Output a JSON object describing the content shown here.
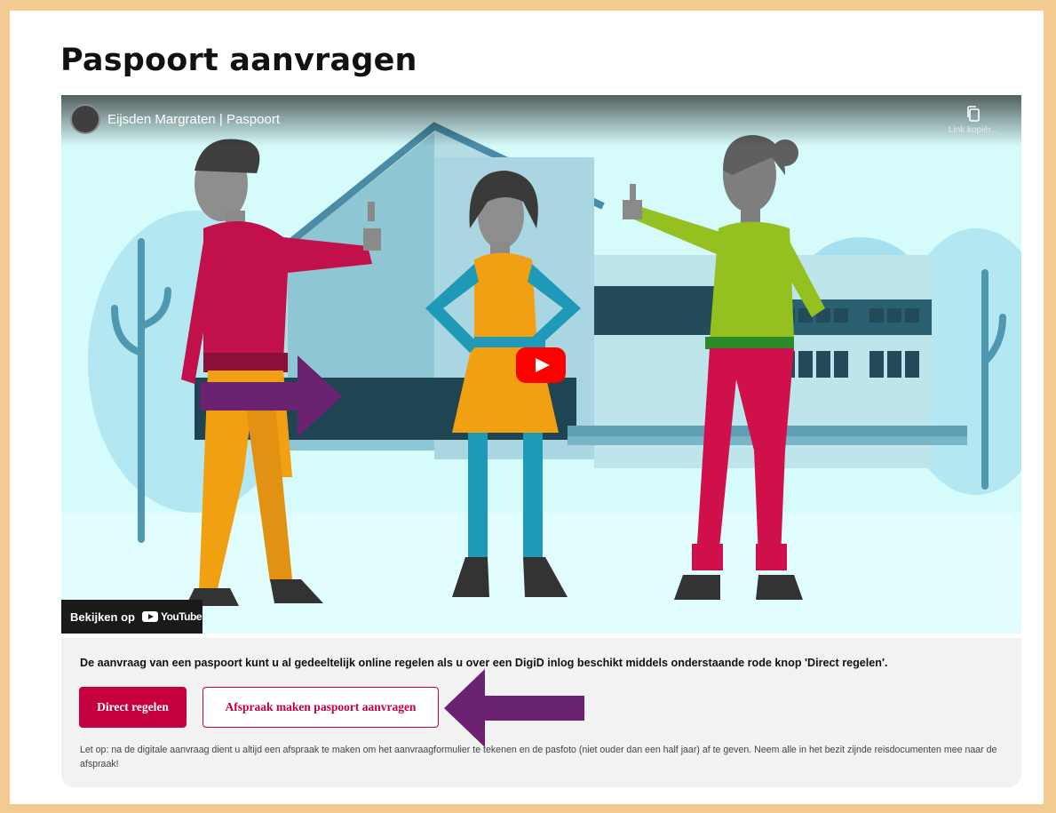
{
  "page": {
    "title": "Paspoort aanvragen"
  },
  "video": {
    "channel_title": "Eijsden Margraten | Paspoort",
    "copy_link_label": "Link kopiër...",
    "watch_on_label": "Bekijken op",
    "youtube_wordmark": "YouTube"
  },
  "info": {
    "intro": "De aanvraag van een paspoort kunt u al gedeeltelijk online regelen als u over een DigiD inlog beschikt middels onderstaande rode knop 'Direct regelen'.",
    "primary_button": "Direct regelen",
    "secondary_button": "Afspraak maken paspoort aanvragen",
    "note": "Let op: na de digitale aanvraag dient u altijd een afspraak te maken om het aanvraagformulier te tekenen en de pasfoto (niet ouder dan een half jaar) af te geven. Neem alle in het bezit zijnde reisdocumenten mee naar de afspraak!"
  },
  "colors": {
    "frame_border": "#f3ca92",
    "brand_red": "#c6003f",
    "annotation_arrow": "#6b2270",
    "youtube_red": "#ff0000"
  },
  "icons": [
    "copy-icon",
    "play-icon",
    "youtube-logo-icon",
    "arrow-right-icon",
    "arrow-left-icon"
  ]
}
